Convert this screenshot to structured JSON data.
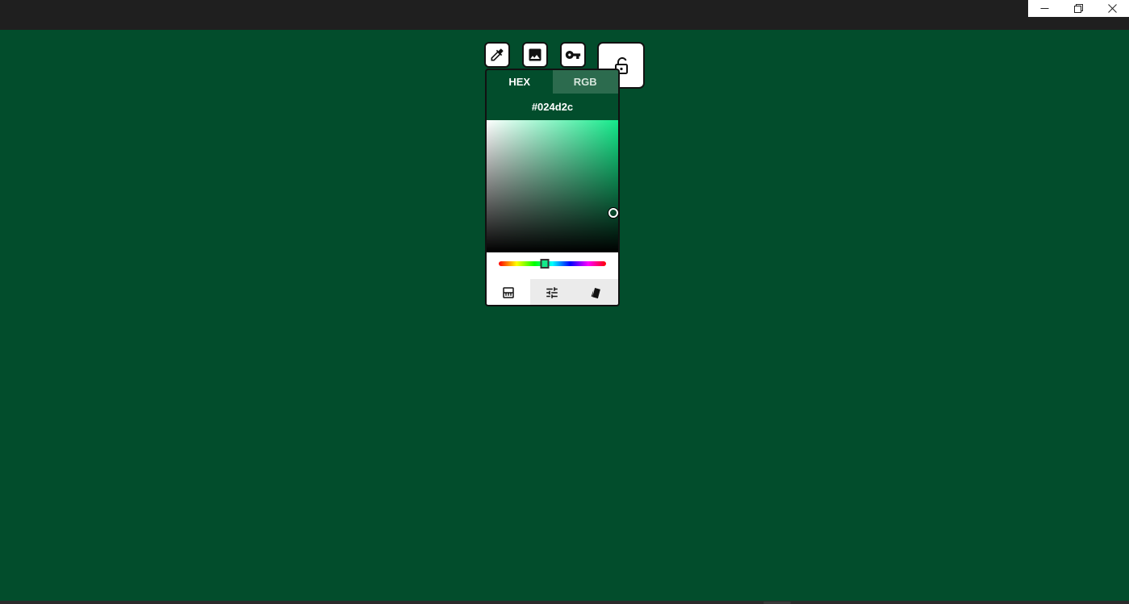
{
  "window": {
    "controls": [
      {
        "name": "minimize",
        "icon": "minimize-icon"
      },
      {
        "name": "restore",
        "icon": "restore-icon"
      },
      {
        "name": "close",
        "icon": "close-icon"
      }
    ]
  },
  "toolbar": {
    "tools": [
      {
        "name": "eyedropper",
        "icon": "eyedropper-icon"
      },
      {
        "name": "image",
        "icon": "image-icon"
      },
      {
        "name": "key",
        "icon": "key-icon"
      },
      {
        "name": "lock",
        "icon": "unlock-icon"
      }
    ]
  },
  "picker": {
    "tabs": [
      {
        "label": "HEX",
        "active": true
      },
      {
        "label": "RGB",
        "active": false
      }
    ],
    "hex_value": "#024d2c",
    "colors": {
      "background": "#024d2c",
      "pure_hue": "#14e98a",
      "inactive_tab": "#2c6b4e"
    },
    "saturation": 1.0,
    "brightness": 0.3,
    "hue_position": 0.43,
    "modes": [
      {
        "name": "gradient-picker",
        "icon": "gradient-icon",
        "active": true
      },
      {
        "name": "sliders",
        "icon": "sliders-icon",
        "active": false
      },
      {
        "name": "swatches",
        "icon": "swatches-icon",
        "active": false
      }
    ]
  }
}
